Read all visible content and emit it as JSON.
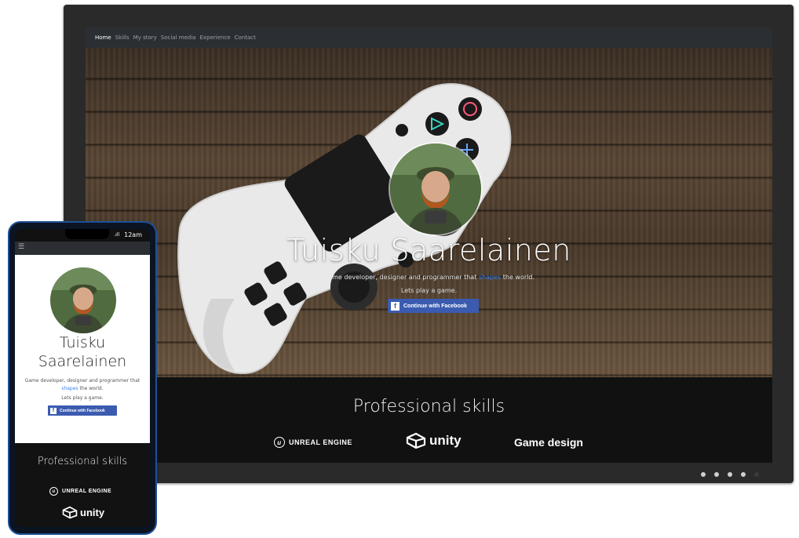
{
  "nav": {
    "items": [
      {
        "label": "Home",
        "active": true
      },
      {
        "label": "Skills",
        "active": false
      },
      {
        "label": "My story",
        "active": false
      },
      {
        "label": "Social media",
        "active": false
      },
      {
        "label": "Experience",
        "active": false
      },
      {
        "label": "Contact",
        "active": false
      }
    ]
  },
  "hero": {
    "name": "Tuisku Saarelainen",
    "tagline_before": "Game developer, designer and programmer that ",
    "tagline_accent": "shapes",
    "tagline_after": " the world.",
    "play_text": "Lets play a game.",
    "facebook_button": "Continue with Facebook",
    "facebook_icon": "f"
  },
  "skills": {
    "title": "Professional skills",
    "items": [
      {
        "label": "UNREAL ENGINE",
        "icon": "unreal-engine-logo"
      },
      {
        "label": "unity",
        "icon": "unity-logo"
      },
      {
        "label": "Game design",
        "icon": ""
      }
    ]
  },
  "carousel": {
    "total": 5,
    "active_count": 4
  },
  "phone": {
    "time": "12am",
    "signal": ".ıll",
    "name_line1": "Tuisku",
    "name_line2": "Saarelainen",
    "tagline_before": "Game developer, designer and programmer that ",
    "tagline_accent": "shapes",
    "tagline_after": " the world.",
    "play_text": "Lets play a game.",
    "facebook_button": "Continue with Facebook",
    "skills_title": "Professional skills",
    "skills": [
      {
        "label": "UNREAL ENGINE",
        "icon": "unreal-engine-logo"
      },
      {
        "label": "unity",
        "icon": "unity-logo"
      }
    ]
  },
  "colors": {
    "accent": "#3b82f6",
    "facebook": "#3b5bb0",
    "nav_bg": "#2b2f33",
    "skills_bg": "#111111"
  }
}
